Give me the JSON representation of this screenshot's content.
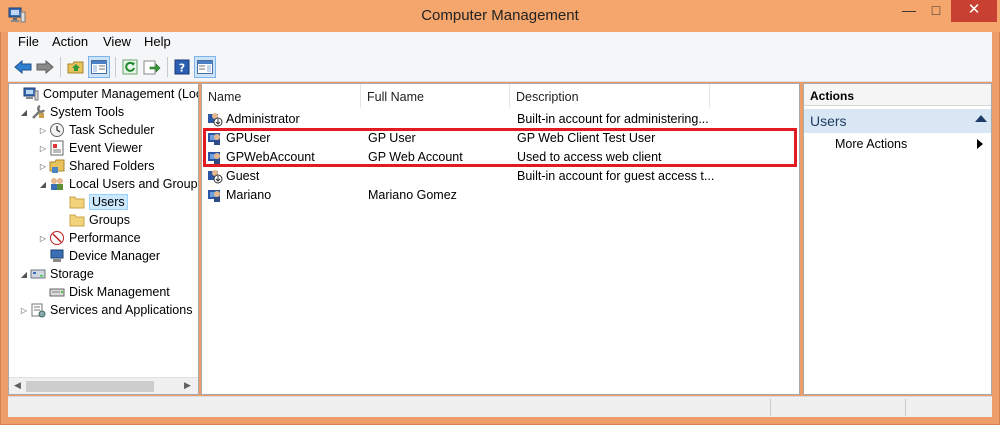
{
  "window": {
    "title": "Computer Management",
    "controls": {
      "minimize": "—",
      "maximize": "□",
      "close": "✕"
    }
  },
  "menu": [
    "File",
    "Action",
    "View",
    "Help"
  ],
  "toolbar": {
    "buttons": [
      "back-arrow-icon",
      "forward-arrow-icon",
      "up-folder-icon",
      "show-hide-tree-icon",
      "refresh-icon",
      "export-list-icon",
      "help-icon",
      "show-hide-action-pane-icon"
    ]
  },
  "tree": {
    "items": [
      {
        "label": "Computer Management (Local",
        "level": 0,
        "expander": "",
        "icon": "computer-management-icon"
      },
      {
        "label": "System Tools",
        "level": 1,
        "expander": "◢",
        "icon": "system-tools-icon"
      },
      {
        "label": "Task Scheduler",
        "level": 2,
        "expander": "▷",
        "icon": "clock-icon"
      },
      {
        "label": "Event Viewer",
        "level": 2,
        "expander": "▷",
        "icon": "event-viewer-icon"
      },
      {
        "label": "Shared Folders",
        "level": 2,
        "expander": "▷",
        "icon": "shared-folder-icon"
      },
      {
        "label": "Local Users and Groups",
        "level": 2,
        "expander": "◢",
        "icon": "users-groups-icon"
      },
      {
        "label": "Users",
        "level": 3,
        "expander": "",
        "icon": "folder-icon",
        "selected": true
      },
      {
        "label": "Groups",
        "level": 3,
        "expander": "",
        "icon": "folder-icon"
      },
      {
        "label": "Performance",
        "level": 2,
        "expander": "▷",
        "icon": "performance-icon"
      },
      {
        "label": "Device Manager",
        "level": 2,
        "expander": "",
        "icon": "device-manager-icon"
      },
      {
        "label": "Storage",
        "level": 1,
        "expander": "◢",
        "icon": "storage-icon"
      },
      {
        "label": "Disk Management",
        "level": 2,
        "expander": "",
        "icon": "disk-management-icon"
      },
      {
        "label": "Services and Applications",
        "level": 1,
        "expander": "▷",
        "icon": "services-icon"
      }
    ]
  },
  "list": {
    "columns": [
      "Name",
      "Full Name",
      "Description"
    ],
    "rows": [
      {
        "name": "Administrator",
        "full_name": "",
        "description": "Built-in account for administering...",
        "icon": "user-disabled-icon"
      },
      {
        "name": "GPUser",
        "full_name": "GP User",
        "description": "GP Web Client Test User",
        "icon": "user-icon"
      },
      {
        "name": "GPWebAccount",
        "full_name": "GP Web Account",
        "description": "Used to access web client",
        "icon": "user-icon"
      },
      {
        "name": "Guest",
        "full_name": "",
        "description": "Built-in account for guest access t...",
        "icon": "user-disabled-icon"
      },
      {
        "name": "Mariano",
        "full_name": "Mariano Gomez",
        "description": "",
        "icon": "user-icon"
      }
    ]
  },
  "actions": {
    "header": "Actions",
    "section": "Users",
    "items": [
      "More Actions"
    ]
  },
  "colors": {
    "title_bar": "#f5a66c",
    "highlight_box": "#e21b23",
    "selection": "#cce8ff",
    "action_section": "#d9e7f5"
  }
}
